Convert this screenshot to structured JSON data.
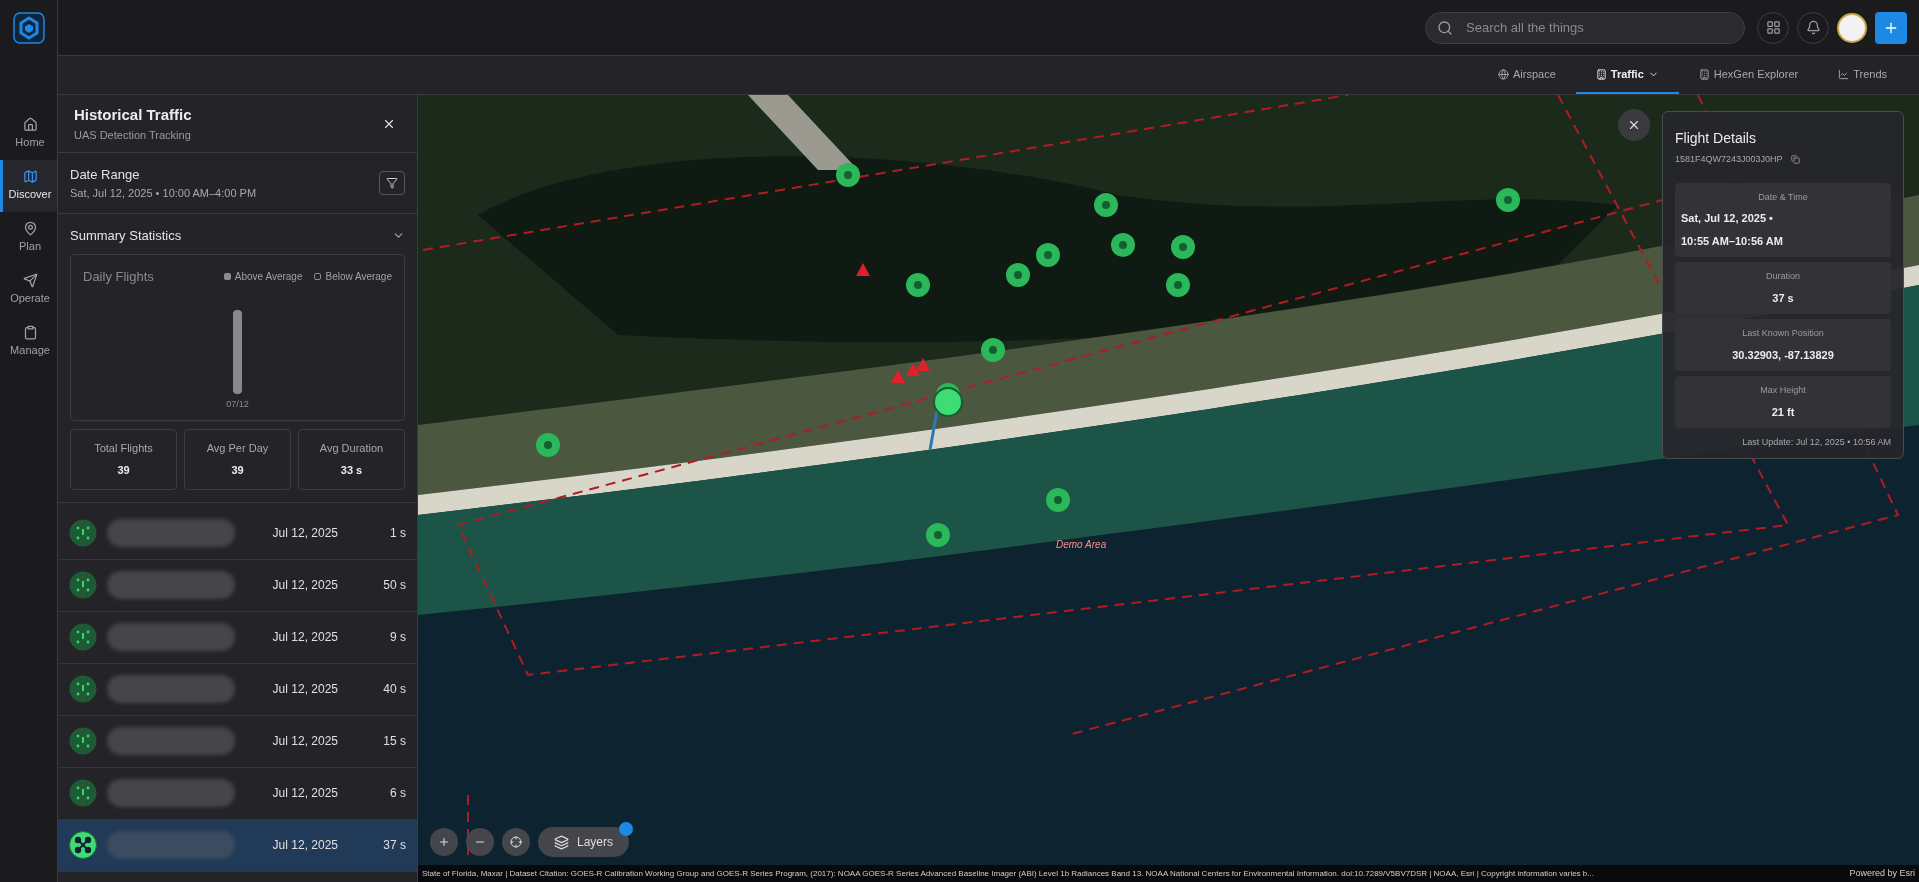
{
  "nav_items": [
    {
      "label": "Home",
      "selected": false
    },
    {
      "label": "Discover",
      "selected": true
    },
    {
      "label": "Plan",
      "selected": false
    },
    {
      "label": "Operate",
      "selected": false
    },
    {
      "label": "Manage",
      "selected": false
    }
  ],
  "search": {
    "placeholder": "Search all the things"
  },
  "tabs": [
    {
      "label": "Airspace",
      "selected": false,
      "dropdown": false
    },
    {
      "label": "Traffic",
      "selected": true,
      "dropdown": true
    },
    {
      "label": "HexGen Explorer",
      "selected": false,
      "dropdown": false
    },
    {
      "label": "Trends",
      "selected": false,
      "dropdown": false
    }
  ],
  "panel": {
    "title": "Historical Traffic",
    "subtitle": "UAS Detection Tracking",
    "date_range": {
      "label": "Date Range",
      "value": "Sat, Jul 12, 2025 • 10:00 AM–4:00 PM"
    },
    "summary": {
      "title": "Summary Statistics",
      "expanded": true
    },
    "chart": {
      "title": "Daily Flights",
      "legend": [
        {
          "label": "Above Average",
          "kind": "filled"
        },
        {
          "label": "Below Average",
          "kind": "hollow"
        }
      ],
      "category": "07/12"
    },
    "stats": [
      {
        "label": "Total Flights",
        "value": "39"
      },
      {
        "label": "Avg Per Day",
        "value": "39"
      },
      {
        "label": "Avg Duration",
        "value": "33 s"
      }
    ],
    "flights": [
      {
        "date": "Jul 12, 2025",
        "duration": "1 s",
        "selected": false
      },
      {
        "date": "Jul 12, 2025",
        "duration": "50 s",
        "selected": false
      },
      {
        "date": "Jul 12, 2025",
        "duration": "9 s",
        "selected": false
      },
      {
        "date": "Jul 12, 2025",
        "duration": "40 s",
        "selected": false
      },
      {
        "date": "Jul 12, 2025",
        "duration": "15 s",
        "selected": false
      },
      {
        "date": "Jul 12, 2025",
        "duration": "6 s",
        "selected": false
      },
      {
        "date": "Jul 12, 2025",
        "duration": "37 s",
        "selected": true
      }
    ]
  },
  "flight_details": {
    "title": "Flight Details",
    "id": "1581F4QW7243J003J0HP",
    "sections": [
      {
        "label": "Date & Time",
        "lines": [
          "Sat, Jul 12, 2025 •",
          "10:55 AM–10:56 AM"
        ]
      },
      {
        "label": "Duration",
        "lines": [
          "37 s"
        ]
      },
      {
        "label": "Last Known Position",
        "lines": [
          "30.32903, -87.13829"
        ]
      },
      {
        "label": "Max Height",
        "lines": [
          "21 ft"
        ]
      }
    ],
    "last_update": "Last Update: Jul 12, 2025 • 10:56 AM"
  },
  "map": {
    "area_label": "Demo Area",
    "layers_button": "Layers",
    "layers_badge": true,
    "attribution": "State of Florida, Maxar | Dataset Citation: GOES-R Calibration Working Group and GOES-R Series Program, (2017): NOAA GOES-R Series Advanced Baseline Imager (ABI) Level 1b Radiances Band 13. NOAA National Centers for Environmental Information. doi:10.7289/V5BV7DSR | NOAA, Esri | Copyright information varies b...",
    "powered_by": "Powered by Esri"
  }
}
